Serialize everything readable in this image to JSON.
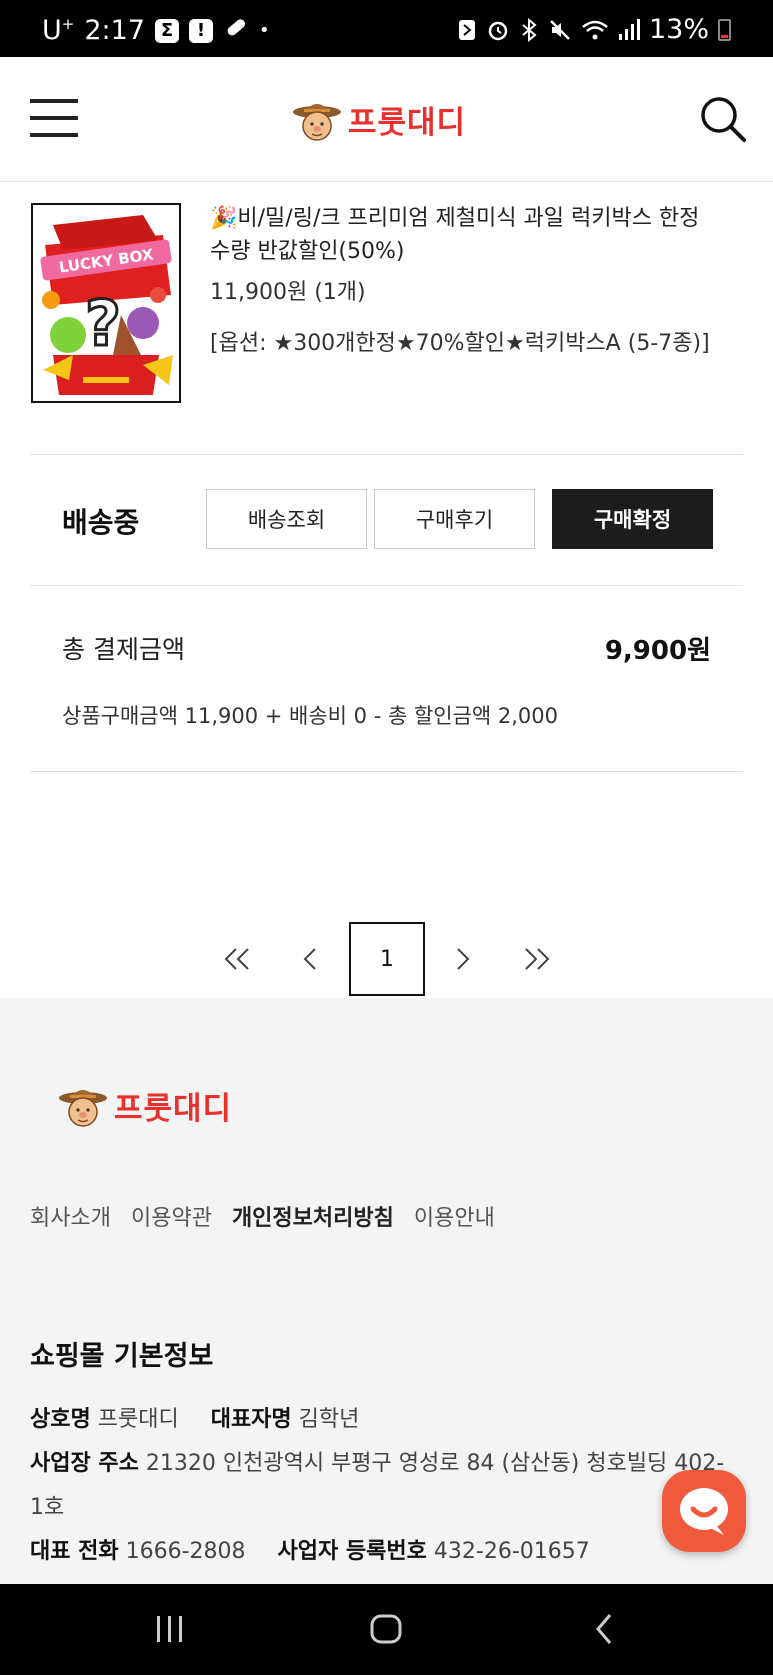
{
  "status_bar": {
    "carrier": "U",
    "carrier_sup": "+",
    "time": "2:17",
    "badge_sigma": "Σ",
    "badge_alert": "!",
    "dot": "•",
    "battery": "13%"
  },
  "header": {
    "logo_text": "프룻대디",
    "icons": [
      "hamburger-menu-icon",
      "search-icon"
    ]
  },
  "order_item": {
    "title_emoji": "🎉",
    "title": "비/밀/링/크 프리미엄 제철미식 과일 럭키박스 한정수량 반값할인(50%)",
    "price_qty": "11,900원 (1개)",
    "option": "[옵션: ★300개한정★70%할인★럭키박스A (5-7종)]",
    "thumbnail_text": "LUCKY BOX",
    "thumbnail_mark": "?"
  },
  "order_status": {
    "label": "배송중",
    "buttons": [
      "배송조회",
      "구매후기",
      "구매확정"
    ]
  },
  "total": {
    "label": "총 결제금액",
    "amount": "9,900원",
    "breakdown": "상품구매금액 11,900 + 배송비 0 - 총 할인금액 2,000"
  },
  "pagination": {
    "current": "1"
  },
  "footer": {
    "logo_text": "프룻대디",
    "links": [
      "회사소개",
      "이용약관",
      "개인정보처리방침",
      "이용안내"
    ],
    "section_title": "쇼핑몰 기본정보",
    "company_label": "상호명",
    "company_value": "프룻대디",
    "ceo_label": "대표자명",
    "ceo_value": "김학년",
    "address_label": "사업장 주소",
    "address_value": "21320 인천광역시 부평구 영성로 84 (삼산동) 청호빌딩 402-1호",
    "phone_label": "대표 전화",
    "phone_value": "1666-2808",
    "bizno_label": "사업자 등록번호",
    "bizno_value": "432-26-01657"
  },
  "colors": {
    "brand_red": "#e8312f",
    "chat_orange": "#f0593b",
    "dark_button": "#1c1c1c"
  }
}
